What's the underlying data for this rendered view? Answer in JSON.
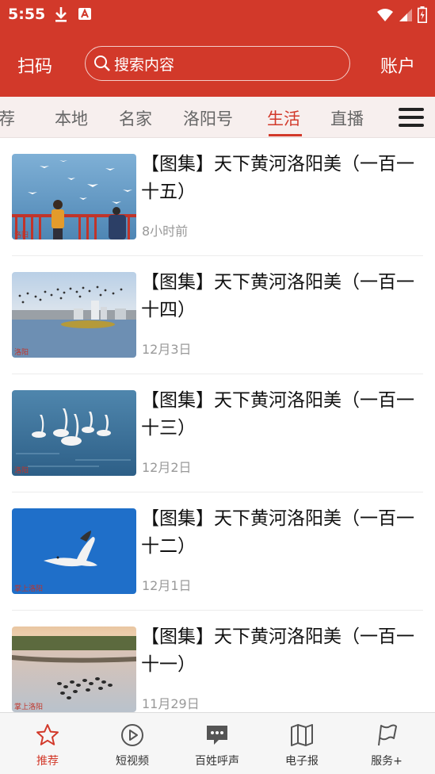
{
  "status_bar": {
    "time": "5:55"
  },
  "header": {
    "scan_label": "扫码",
    "search_placeholder": "搜索内容",
    "account_label": "账户"
  },
  "tabs": [
    {
      "label": "荐",
      "active": false
    },
    {
      "label": "本地",
      "active": false
    },
    {
      "label": "名家",
      "active": false
    },
    {
      "label": "洛阳号",
      "active": false
    },
    {
      "label": "生活",
      "active": true
    },
    {
      "label": "直播",
      "active": false
    }
  ],
  "news": [
    {
      "title": "【图集】天下黄河洛阳美（一百一十五）",
      "time": "8小时前",
      "watermark": "洛阳"
    },
    {
      "title": "【图集】天下黄河洛阳美（一百一十四）",
      "time": "12月3日",
      "watermark": "洛阳"
    },
    {
      "title": "【图集】天下黄河洛阳美（一百一十三）",
      "time": "12月2日",
      "watermark": "洛阳"
    },
    {
      "title": "【图集】天下黄河洛阳美（一百一十二）",
      "time": "12月1日",
      "watermark": "掌上洛阳"
    },
    {
      "title": "【图集】天下黄河洛阳美（一百一十一）",
      "time": "11月29日",
      "watermark": "掌上洛阳"
    }
  ],
  "bottom_nav": [
    {
      "label": "推荐",
      "icon": "star-icon",
      "active": true
    },
    {
      "label": "短视频",
      "icon": "play-circle-icon",
      "active": false
    },
    {
      "label": "百姓呼声",
      "icon": "chat-bubble-icon",
      "active": false
    },
    {
      "label": "电子报",
      "icon": "map-book-icon",
      "active": false
    },
    {
      "label": "服务+",
      "icon": "flag-icon",
      "active": false
    }
  ],
  "colors": {
    "brand_red": "#d2392a",
    "tab_bg": "#f7efee",
    "muted_text": "#999999"
  }
}
